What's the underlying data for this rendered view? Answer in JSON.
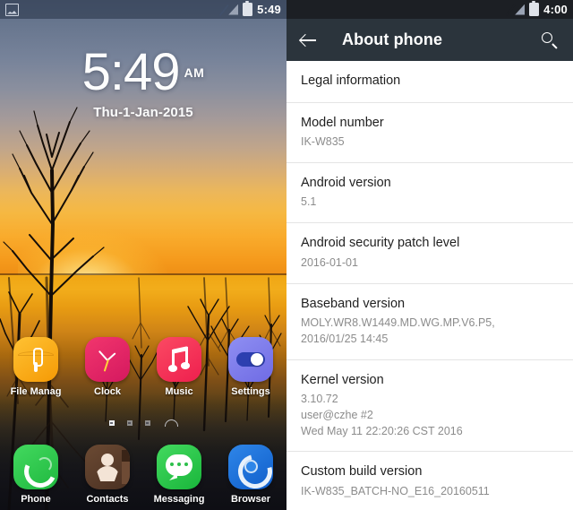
{
  "home": {
    "status_bar": {
      "notification_icon": "screenshot-icon",
      "signal_icon": "no-signal-icon",
      "battery_icon": "battery-full-icon",
      "time": "5:49"
    },
    "clock": {
      "time": "5:49",
      "ampm": "AM",
      "date": "Thu-1-Jan-2015"
    },
    "app_rows": [
      [
        {
          "label": "File Manag",
          "icon": "file-manager-icon"
        },
        {
          "label": "Clock",
          "icon": "clock-icon"
        },
        {
          "label": "Music",
          "icon": "music-icon"
        },
        {
          "label": "Settings",
          "icon": "settings-icon"
        }
      ],
      [
        {
          "label": "Phone",
          "icon": "phone-icon"
        },
        {
          "label": "Contacts",
          "icon": "contacts-icon"
        },
        {
          "label": "Messaging",
          "icon": "messaging-icon"
        },
        {
          "label": "Browser",
          "icon": "browser-icon"
        }
      ]
    ],
    "page_indicator": {
      "count": 3,
      "active": 0,
      "handle": "home-handle-icon"
    }
  },
  "about": {
    "status_bar": {
      "signal_icon": "no-signal-icon",
      "battery_icon": "battery-full-icon",
      "time": "4:00"
    },
    "toolbar": {
      "back_icon": "back-arrow-icon",
      "title": "About phone",
      "search_icon": "search-icon"
    },
    "items": [
      {
        "title": "Legal information",
        "sub": ""
      },
      {
        "title": "Model number",
        "sub": "IK-W835"
      },
      {
        "title": "Android version",
        "sub": "5.1"
      },
      {
        "title": "Android security patch level",
        "sub": "2016-01-01"
      },
      {
        "title": "Baseband version",
        "sub": "MOLY.WR8.W1449.MD.WG.MP.V6.P5,\n2016/01/25 14:45"
      },
      {
        "title": "Kernel version",
        "sub": "3.10.72\nuser@czhe #2\nWed May 11 22:20:26 CST 2016"
      },
      {
        "title": "Custom build version",
        "sub": "IK-W835_BATCH-NO_E16_20160511"
      }
    ]
  },
  "colors": {
    "toolbar_bg": "#2b343c",
    "status_bar_dark": "#1c1f24",
    "list_bg": "#ffffff",
    "title_text": "#1f1f1f",
    "sub_text": "#8c8c8c"
  }
}
